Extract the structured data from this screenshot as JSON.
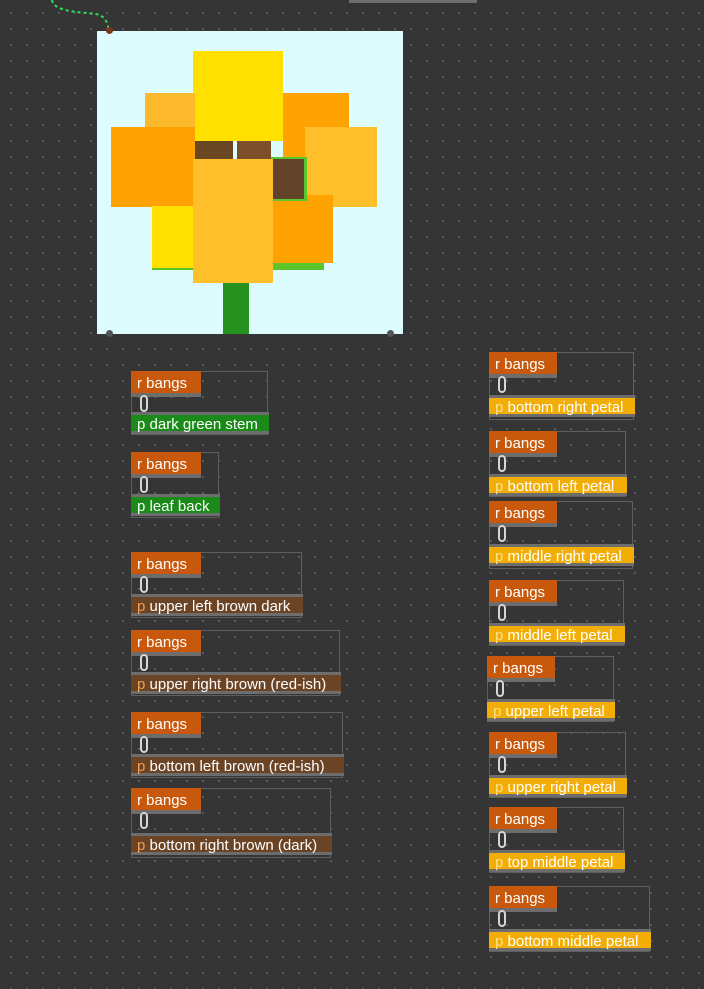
{
  "colors": {
    "background": "#353535",
    "canvas_bg": "#dcfcfd",
    "receive_node": "#c8580c",
    "stem_green": "#1a8a18",
    "leaf_green": "#1a8a18",
    "brown_node": "#6b4325",
    "petal_node": "#f2ae06",
    "petal_text": "#ffffff",
    "petal_prefix": "#fbe08a",
    "wire": "#2fe05b"
  },
  "canvas": {
    "shapes": [
      {
        "name": "stem",
        "color": "#27911f"
      },
      {
        "name": "leaf-back",
        "color": "#5ac62c"
      },
      {
        "name": "upper-left-brown-dark",
        "color": "#6a4723"
      },
      {
        "name": "upper-right-brown",
        "color": "#7c4e29"
      },
      {
        "name": "bottom-left-brown",
        "color": "#7c4e29"
      },
      {
        "name": "bottom-right-brown-dark",
        "color": "#63422a"
      },
      {
        "name": "top-middle-petal",
        "color": "#ffe000"
      },
      {
        "name": "upper-left-petal",
        "color": "#fbb92b"
      },
      {
        "name": "upper-right-petal",
        "color": "#ffa303"
      },
      {
        "name": "middle-left-petal",
        "color": "#ffa102"
      },
      {
        "name": "middle-right-petal",
        "color": "#ffbf2b"
      },
      {
        "name": "bottom-left-petal",
        "color": "#ffe000"
      },
      {
        "name": "bottom-right-petal",
        "color": "#ffa303"
      },
      {
        "name": "bottom-middle-petal",
        "color": "#ffbf2b"
      }
    ]
  },
  "nodes_left": [
    {
      "receive_prefix": "r",
      "receive_label": "bangs",
      "paint_prefix": "p",
      "paint_label": "dark green stem",
      "kind": "green"
    },
    {
      "receive_prefix": "r",
      "receive_label": "bangs",
      "paint_prefix": "p",
      "paint_label": "leaf back",
      "kind": "green"
    },
    {
      "receive_prefix": "r",
      "receive_label": "bangs",
      "paint_prefix": "p",
      "paint_label": "upper left brown dark",
      "kind": "brown"
    },
    {
      "receive_prefix": "r",
      "receive_label": "bangs",
      "paint_prefix": "p",
      "paint_label": "upper right brown (red-ish)",
      "kind": "brown"
    },
    {
      "receive_prefix": "r",
      "receive_label": "bangs",
      "paint_prefix": "p",
      "paint_label": "bottom left brown (red-ish)",
      "kind": "brown"
    },
    {
      "receive_prefix": "r",
      "receive_label": "bangs",
      "paint_prefix": "p",
      "paint_label": "bottom right brown (dark)",
      "kind": "brown"
    }
  ],
  "nodes_right": [
    {
      "receive_prefix": "r",
      "receive_label": "bangs",
      "paint_prefix": "p",
      "paint_label": "bottom right petal"
    },
    {
      "receive_prefix": "r",
      "receive_label": "bangs",
      "paint_prefix": "p",
      "paint_label": "bottom left petal"
    },
    {
      "receive_prefix": "r",
      "receive_label": "bangs",
      "paint_prefix": "p",
      "paint_label": "middle right petal"
    },
    {
      "receive_prefix": "r",
      "receive_label": "bangs",
      "paint_prefix": "p",
      "paint_label": "middle left petal"
    },
    {
      "receive_prefix": "r",
      "receive_label": "bangs",
      "paint_prefix": "p",
      "paint_label": "upper left petal"
    },
    {
      "receive_prefix": "r",
      "receive_label": "bangs",
      "paint_prefix": "p",
      "paint_label": "upper right petal"
    },
    {
      "receive_prefix": "r",
      "receive_label": "bangs",
      "paint_prefix": "p",
      "paint_label": "top middle petal"
    },
    {
      "receive_prefix": "r",
      "receive_label": "bangs",
      "paint_prefix": "p",
      "paint_label": "bottom middle petal"
    }
  ]
}
